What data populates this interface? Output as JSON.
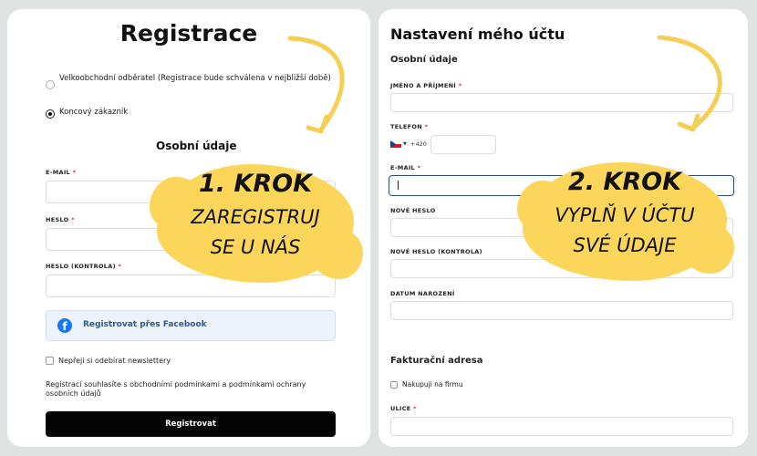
{
  "registration": {
    "title": "Registrace",
    "radio_wholesale": "Velkoobchodní odběratel  (Registrace bude schválena v nejbližší době)",
    "radio_end_customer": "Koncový zákazník",
    "section_personal": "Osobní údaje",
    "email_label": "E-MAIL",
    "password_label": "HESLO",
    "password_confirm_label": "HESLO (KONTROLA)",
    "required_mark": "*",
    "facebook_button": "Registrovat přes Facebook",
    "newsletter_label": "Nepřeji si odebírat newslettery",
    "terms_text": "Registrací souhlasíte s obchodními podmínkami a podmínkami ochrany osobních údajů",
    "register_button": "Registrovat"
  },
  "account": {
    "title": "Nastavení mého účtu",
    "section_personal": "Osobní údaje",
    "name_label": "JMÉNO A PŘÍJMENÍ",
    "phone_label": "TELEFON",
    "phone_prefix": "+420",
    "email_label": "E-MAIL",
    "new_password_label": "NOVÉ HESLO",
    "new_password_confirm_label": "NOVÉ HESLO (KONTROLA)",
    "birthdate_label": "DATUM NAROZENÍ",
    "billing_section": "Fakturační adresa",
    "company_purchase_label": "Nakupuji na firmu",
    "street_label": "ULICE",
    "required_mark": "*"
  },
  "callouts": {
    "step1_heading": "1. KROK",
    "step1_line1": "ZAREGISTRUJ",
    "step1_line2": "SE U NÁS",
    "step2_heading": "2. KROK",
    "step2_line1": "VYPLŇ V ÚČTU",
    "step2_line2": "SVÉ ÚDAJE"
  },
  "colors": {
    "callout": "#fbd65a",
    "arrow": "#f5cf55",
    "facebook": "#1877f2",
    "button_dark": "#050505",
    "focus_border": "#2c4f86"
  },
  "icons": {
    "facebook": "facebook-icon",
    "flag": "czech-flag-icon",
    "arrow": "curved-arrow-icon"
  }
}
